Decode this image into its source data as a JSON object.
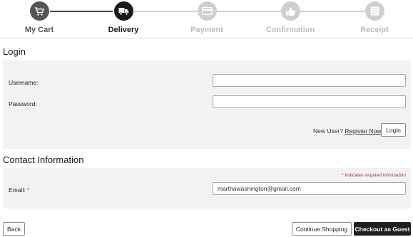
{
  "stepper": {
    "steps": [
      {
        "label": "My Cart",
        "icon": "cart-icon",
        "state": "done"
      },
      {
        "label": "Delivery",
        "icon": "truck-icon",
        "state": "active"
      },
      {
        "label": "Payment",
        "icon": "credit-card-icon",
        "state": "pending"
      },
      {
        "label": "Confirmation",
        "icon": "thumbs-up-icon",
        "state": "pending"
      },
      {
        "label": "Receipt",
        "icon": "receipt-list-icon",
        "state": "pending"
      }
    ]
  },
  "login": {
    "title": "Login",
    "username_label": "Username:",
    "username_value": "",
    "password_label": "Password:",
    "password_value": "",
    "new_user_text": "New User?",
    "register_link": "Register Now",
    "login_button": "Login"
  },
  "contact": {
    "title": "Contact Information",
    "required_note": "* Indicates required information",
    "email_label": "Email:",
    "email_required_marker": "*",
    "email_value": "marthawashington@gmail.com"
  },
  "footer": {
    "back_button": "Back",
    "continue_button": "Continue Shopping",
    "guest_button": "Checkout as Guest"
  },
  "colors": {
    "done": "#555555",
    "active": "#1a1a1a",
    "pending": "#cfcfcf",
    "required": "#c0392b",
    "panel": "#f2f2f2"
  }
}
